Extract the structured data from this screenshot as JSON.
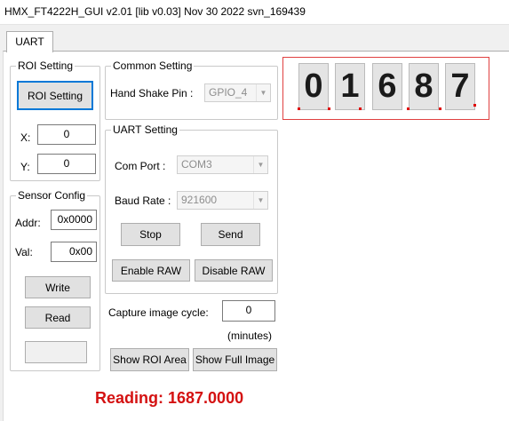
{
  "window": {
    "title": "HMX_FT4222H_GUI v2.01 [lib v0.03] Nov 30 2022 svn_169439"
  },
  "tabs": [
    {
      "label": "UART",
      "active": true
    }
  ],
  "roi_setting": {
    "legend": "ROI Setting",
    "button_label": "ROI Setting",
    "x_label": "X:",
    "x_value": "0",
    "y_label": "Y:",
    "y_value": "0"
  },
  "sensor_config": {
    "legend": "Sensor Config",
    "addr_label": "Addr:",
    "addr_value": "0x0000",
    "val_label": "Val:",
    "val_value": "0x00",
    "write_label": "Write",
    "read_label": "Read",
    "read_result": ""
  },
  "common_setting": {
    "legend": "Common Setting",
    "handshake_label": "Hand Shake Pin :",
    "handshake_value": "GPIO_4"
  },
  "uart_setting": {
    "legend": "UART Setting",
    "com_port_label": "Com Port :",
    "com_port_value": "COM3",
    "baud_rate_label": "Baud Rate :",
    "baud_rate_value": "921600",
    "stop_label": "Stop",
    "send_label": "Send",
    "enable_raw_label": "Enable RAW",
    "disable_raw_label": "Disable RAW"
  },
  "capture": {
    "label": "Capture image cycle:",
    "value": "0",
    "unit": "(minutes)",
    "show_roi_label": "Show ROI Area",
    "show_full_label": "Show Full Image"
  },
  "preview": {
    "digits": [
      "0",
      "1",
      "6",
      "8",
      "7"
    ],
    "marker_color": "#e00000",
    "border_color": "#e04040"
  },
  "reading": {
    "text": "Reading: 1687.0000",
    "color": "#d41111"
  }
}
